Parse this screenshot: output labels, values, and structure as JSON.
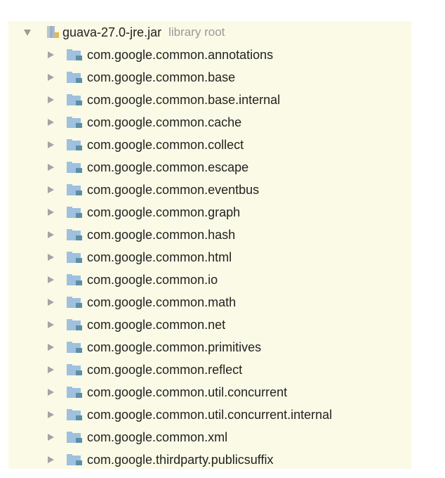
{
  "tree": {
    "root": {
      "label": "guava-27.0-jre.jar",
      "sublabel": "library root",
      "icon": "jar-library-icon",
      "expanded": true
    },
    "packages": [
      "com.google.common.annotations",
      "com.google.common.base",
      "com.google.common.base.internal",
      "com.google.common.cache",
      "com.google.common.collect",
      "com.google.common.escape",
      "com.google.common.eventbus",
      "com.google.common.graph",
      "com.google.common.hash",
      "com.google.common.html",
      "com.google.common.io",
      "com.google.common.math",
      "com.google.common.net",
      "com.google.common.primitives",
      "com.google.common.reflect",
      "com.google.common.util.concurrent",
      "com.google.common.util.concurrent.internal",
      "com.google.common.xml",
      "com.google.thirdparty.publicsuffix"
    ],
    "package_icon": "package-folder-icon",
    "colors": {
      "background": "#fafae6",
      "text": "#222222",
      "secondary_text": "#999999",
      "folder_blue": "#8fb4d6",
      "dot_teal": "#5b8fa8"
    }
  }
}
